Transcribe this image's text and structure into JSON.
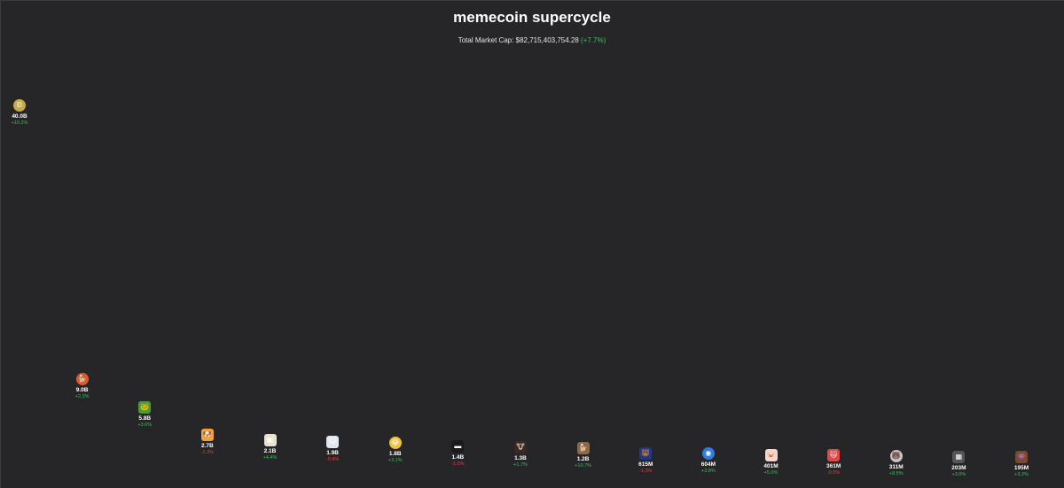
{
  "header": {
    "title": "memecoin supercycle",
    "mcap_label": "Total Market Cap: $82,715,403,754.28",
    "mcap_change": "(+7.7%)"
  },
  "chart_data": {
    "type": "scatter",
    "title": "memecoin supercycle",
    "subtitle": "Total Market Cap: $82,715,403,754.28 (+7.7%)",
    "xlabel": "",
    "ylabel": "",
    "ylim": [
      0,
      40.0
    ],
    "grid": false,
    "points": [
      {
        "value_b": 40.0,
        "label": "40.0B",
        "change": "+10.2%",
        "direction": "up",
        "icon": "doge-coin-icon",
        "color": "#c9a84a",
        "glyph": "Ð",
        "round": true
      },
      {
        "value_b": 9.0,
        "label": "9.0B",
        "change": "+2.3%",
        "direction": "up",
        "icon": "shiba-dog-icon",
        "color": "#e4572e",
        "glyph": "🐕",
        "round": true
      },
      {
        "value_b": 5.8,
        "label": "5.8B",
        "change": "+3.6%",
        "direction": "up",
        "icon": "pepe-frog-icon",
        "color": "#4c9a3e",
        "glyph": "🐸",
        "round": false
      },
      {
        "value_b": 2.7,
        "label": "2.7B",
        "change": "-1.3%",
        "direction": "down",
        "icon": "bonk-dog-icon",
        "color": "#f2a13a",
        "glyph": "🐶",
        "round": false
      },
      {
        "value_b": 2.1,
        "label": "2.1B",
        "change": "+4.4%",
        "direction": "up",
        "icon": "framed-portrait-icon",
        "color": "#e8e2d0",
        "glyph": "▣",
        "round": false
      },
      {
        "value_b": 1.9,
        "label": "1.9B",
        "change": "-0.4%",
        "direction": "down",
        "icon": "white-cat-icon",
        "color": "#dfe6ee",
        "glyph": "🐱",
        "round": false
      },
      {
        "value_b": 1.8,
        "label": "1.8B",
        "change": "+3.1%",
        "direction": "up",
        "icon": "laughing-face-icon",
        "color": "#f2c23a",
        "glyph": "😂",
        "round": true
      },
      {
        "value_b": 1.4,
        "label": "1.4B",
        "change": "-1.5%",
        "direction": "down",
        "icon": "dark-logo-icon",
        "color": "#1a1a1a",
        "glyph": "▬",
        "round": false
      },
      {
        "value_b": 1.3,
        "label": "1.3B",
        "change": "+1.7%",
        "direction": "up",
        "icon": "bull-head-icon",
        "color": "#3a2a22",
        "glyph": "🐮",
        "round": false
      },
      {
        "value_b": 1.2,
        "label": "1.2B",
        "change": "+10.7%",
        "direction": "up",
        "icon": "hat-dog-icon",
        "color": "#8a6a4a",
        "glyph": "🐕",
        "round": false
      },
      {
        "value_b": 0.615,
        "label": "615M",
        "change": "-1.3%",
        "direction": "down",
        "icon": "blue-cat-icon",
        "color": "#1e3a8a",
        "glyph": "🐻",
        "round": false
      },
      {
        "value_b": 0.604,
        "label": "604M",
        "change": "+3.8%",
        "direction": "up",
        "icon": "blue-orb-icon",
        "color": "#2e7de0",
        "glyph": "◉",
        "round": true
      },
      {
        "value_b": 0.401,
        "label": "401M",
        "change": "+5.0%",
        "direction": "up",
        "icon": "pink-pig-icon",
        "color": "#f0d6d6",
        "glyph": "🐷",
        "round": false
      },
      {
        "value_b": 0.361,
        "label": "361M",
        "change": "-0.5%",
        "direction": "down",
        "icon": "red-cat-icon",
        "color": "#e04848",
        "glyph": "🐱",
        "round": false
      },
      {
        "value_b": 0.311,
        "label": "311M",
        "change": "+8.5%",
        "direction": "up",
        "icon": "grey-bear-icon",
        "color": "#c0c6cc",
        "glyph": "🐻",
        "round": true
      },
      {
        "value_b": 0.203,
        "label": "203M",
        "change": "+3.0%",
        "direction": "up",
        "icon": "grey-figure-icon",
        "color": "#555555",
        "glyph": "▦",
        "round": false
      },
      {
        "value_b": 0.195,
        "label": "195M",
        "change": "+3.2%",
        "direction": "up",
        "icon": "pixel-character-icon",
        "color": "#7a4a2a",
        "glyph": "👾",
        "round": false
      }
    ]
  }
}
